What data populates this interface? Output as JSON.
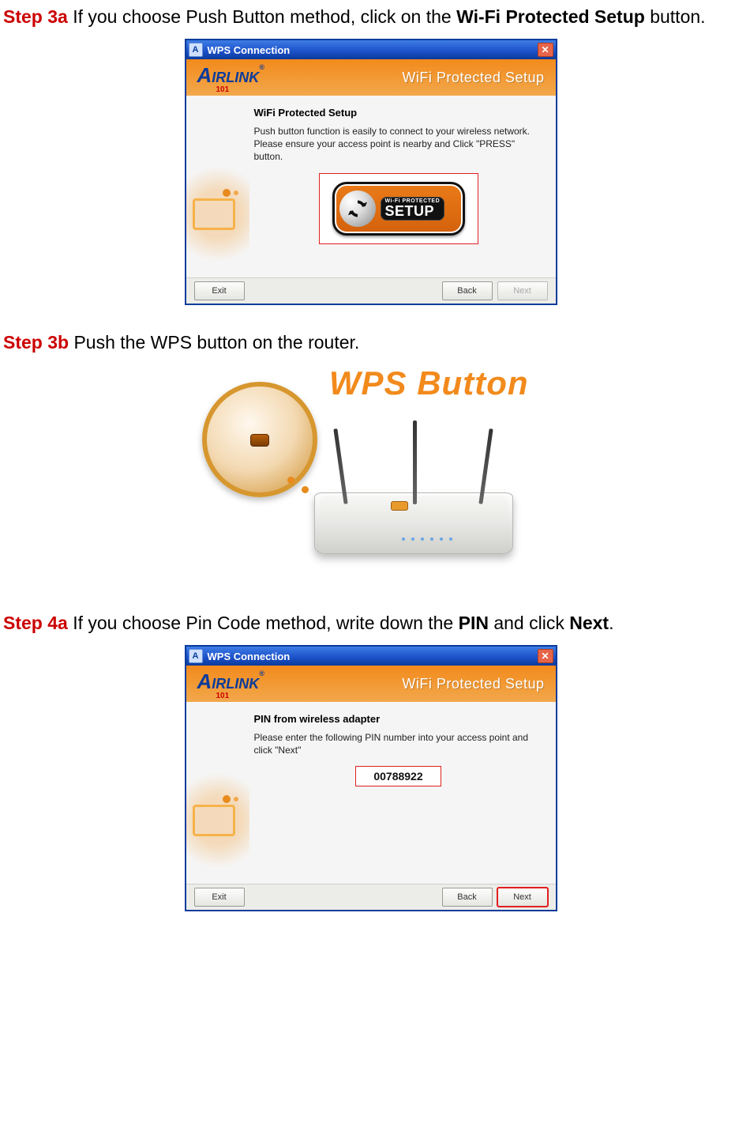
{
  "steps": {
    "s3a": {
      "label": "Step 3a",
      "text_before": " If you choose Push Button method, click on the ",
      "bold": "Wi-Fi Protected Setup",
      "text_after": " button."
    },
    "s3b": {
      "label": "Step 3b",
      "text": " Push the WPS button on the router."
    },
    "s4a": {
      "label": "Step 4a",
      "text_before": " If you choose Pin Code method, write down the ",
      "bold1": "PIN",
      "mid": " and click ",
      "bold2": "Next",
      "text_after": "."
    }
  },
  "window": {
    "title": "WPS Connection",
    "brand": "AirLink",
    "brand_sub": "101",
    "header_text": "WiFi Protected Setup",
    "buttons": {
      "exit": "Exit",
      "back": "Back",
      "next": "Next"
    }
  },
  "dialog_a": {
    "heading": "WiFi Protected Setup",
    "desc": "Push button function is easily to connect to your wireless network. Please ensure your access point is nearby and Click \"PRESS\" button.",
    "wps_small": "Wi-Fi PROTECTED",
    "wps_large": "SETUP"
  },
  "dialog_b": {
    "heading": "PIN from wireless adapter",
    "desc": "Please enter the following PIN number into your access point and click \"Next\"",
    "pin": "00788922"
  },
  "router_label": "WPS Button"
}
